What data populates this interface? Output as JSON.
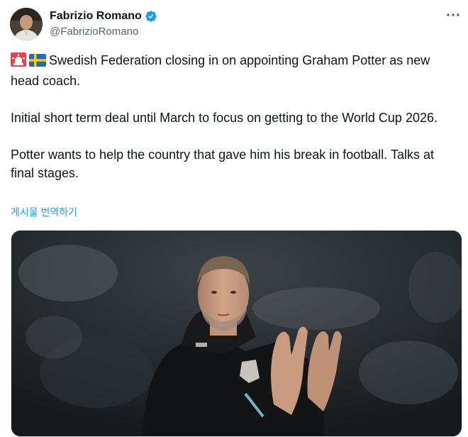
{
  "author": {
    "display_name": "Fabrizio Romano",
    "handle": "@FabrizioRomano",
    "verified_color": "#1d9bf0"
  },
  "tweet": {
    "paragraphs": [
      {
        "emojis": [
          "alarm-siren-emoji",
          "sweden-flag-emoji"
        ],
        "text": "Swedish Federation closing in on appointing Graham Potter as new head coach."
      },
      {
        "text": "Initial short term deal until March to focus on getting to the World Cup 2026."
      },
      {
        "text": "Potter wants to help the country that gave him his break in football. Talks at final stages."
      }
    ],
    "translate_label": "게시물 번역하기"
  },
  "colors": {
    "link": "#1d9bf0",
    "text": "#0f1419",
    "secondary": "#536471"
  },
  "icons": {
    "more": "more-horizontal-icon",
    "verified": "verified-badge-icon"
  }
}
